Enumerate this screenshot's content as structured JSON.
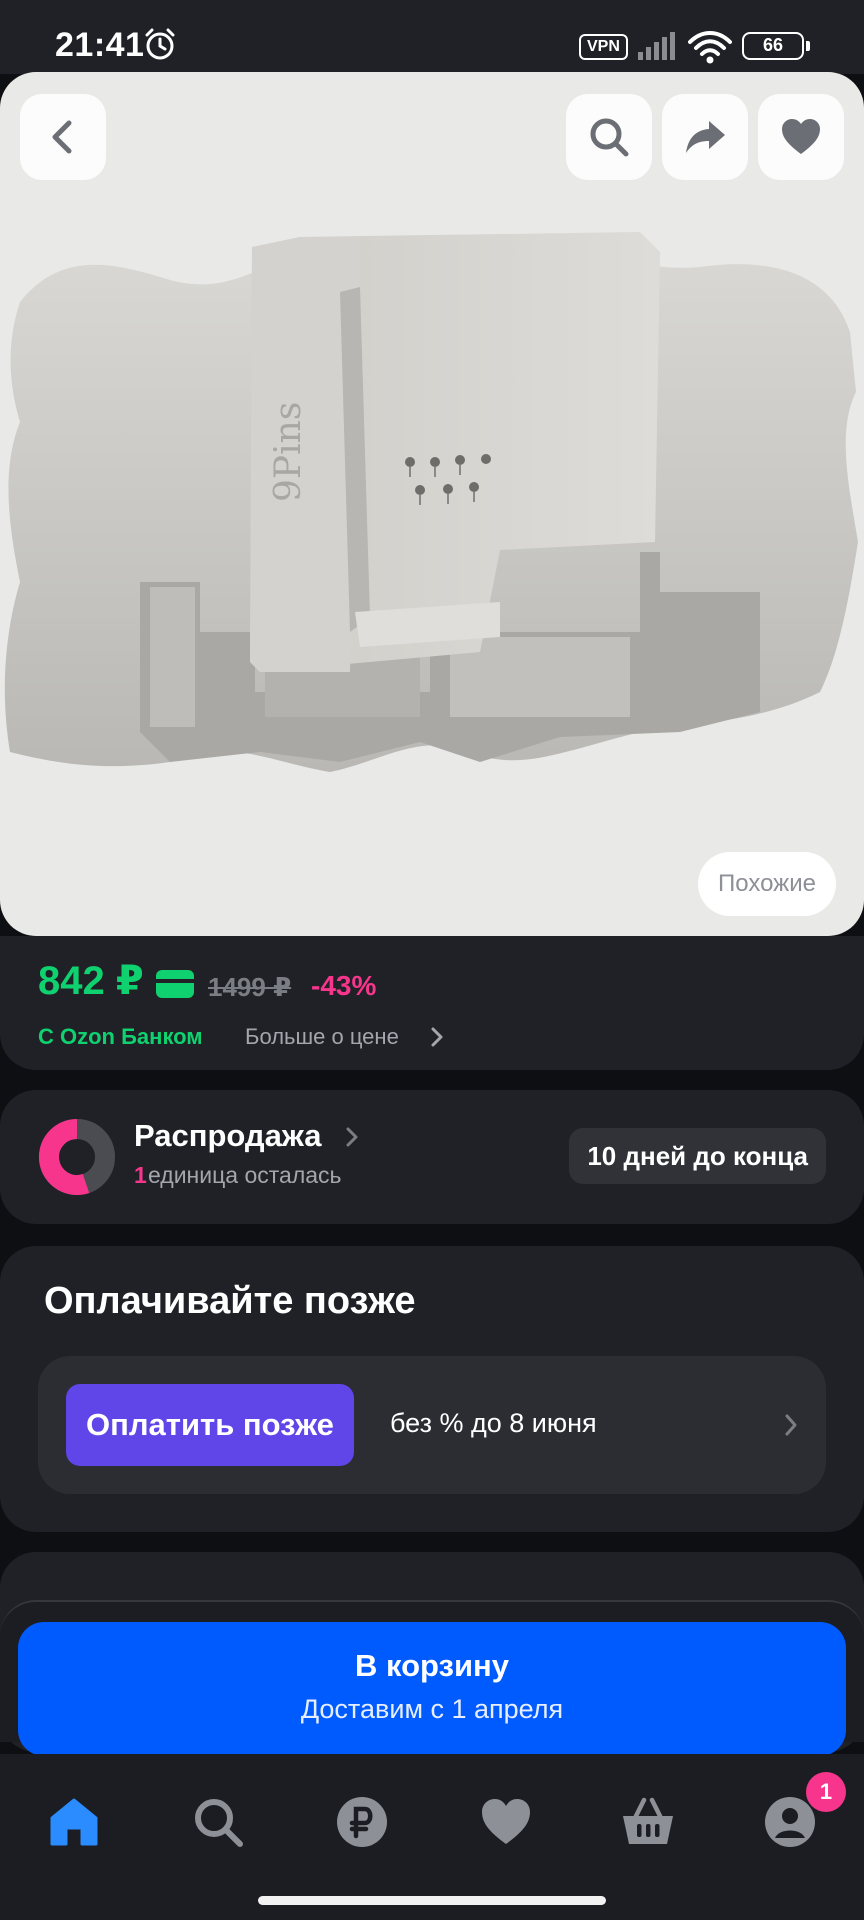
{
  "status_bar": {
    "time": "21:41",
    "vpn_label": "VPN",
    "battery": "66"
  },
  "product": {
    "similar_label": "Похожие",
    "image_text": "9Pins"
  },
  "price": {
    "current": "842 ₽",
    "old": "1499 ₽",
    "discount": "-43%",
    "bank_label": "С Ozon Банком",
    "more_label": "Больше о цене"
  },
  "sale": {
    "title": "Распродажа",
    "count": "1",
    "units_left": "единица осталась",
    "badge": "10 дней до конца"
  },
  "pay_later": {
    "title": "Оплачивайте позже",
    "button_label": "Оплатить позже",
    "terms": "без % до 8 июня"
  },
  "cart": {
    "title": "В корзину",
    "delivery": "Доставим с 1 апреля"
  },
  "nav": {
    "profile_badge": "1"
  },
  "colors": {
    "accent_green": "#10d16f",
    "accent_pink": "#f7358c",
    "cart_blue": "#005bff",
    "pay_purple": "#6046e8",
    "nav_active": "#2b8cff"
  },
  "icons": [
    "back-icon",
    "search-icon",
    "share-icon",
    "heart-icon",
    "home-icon",
    "catalog-search-icon",
    "ruble-icon",
    "favorites-icon",
    "basket-icon",
    "profile-icon"
  ]
}
